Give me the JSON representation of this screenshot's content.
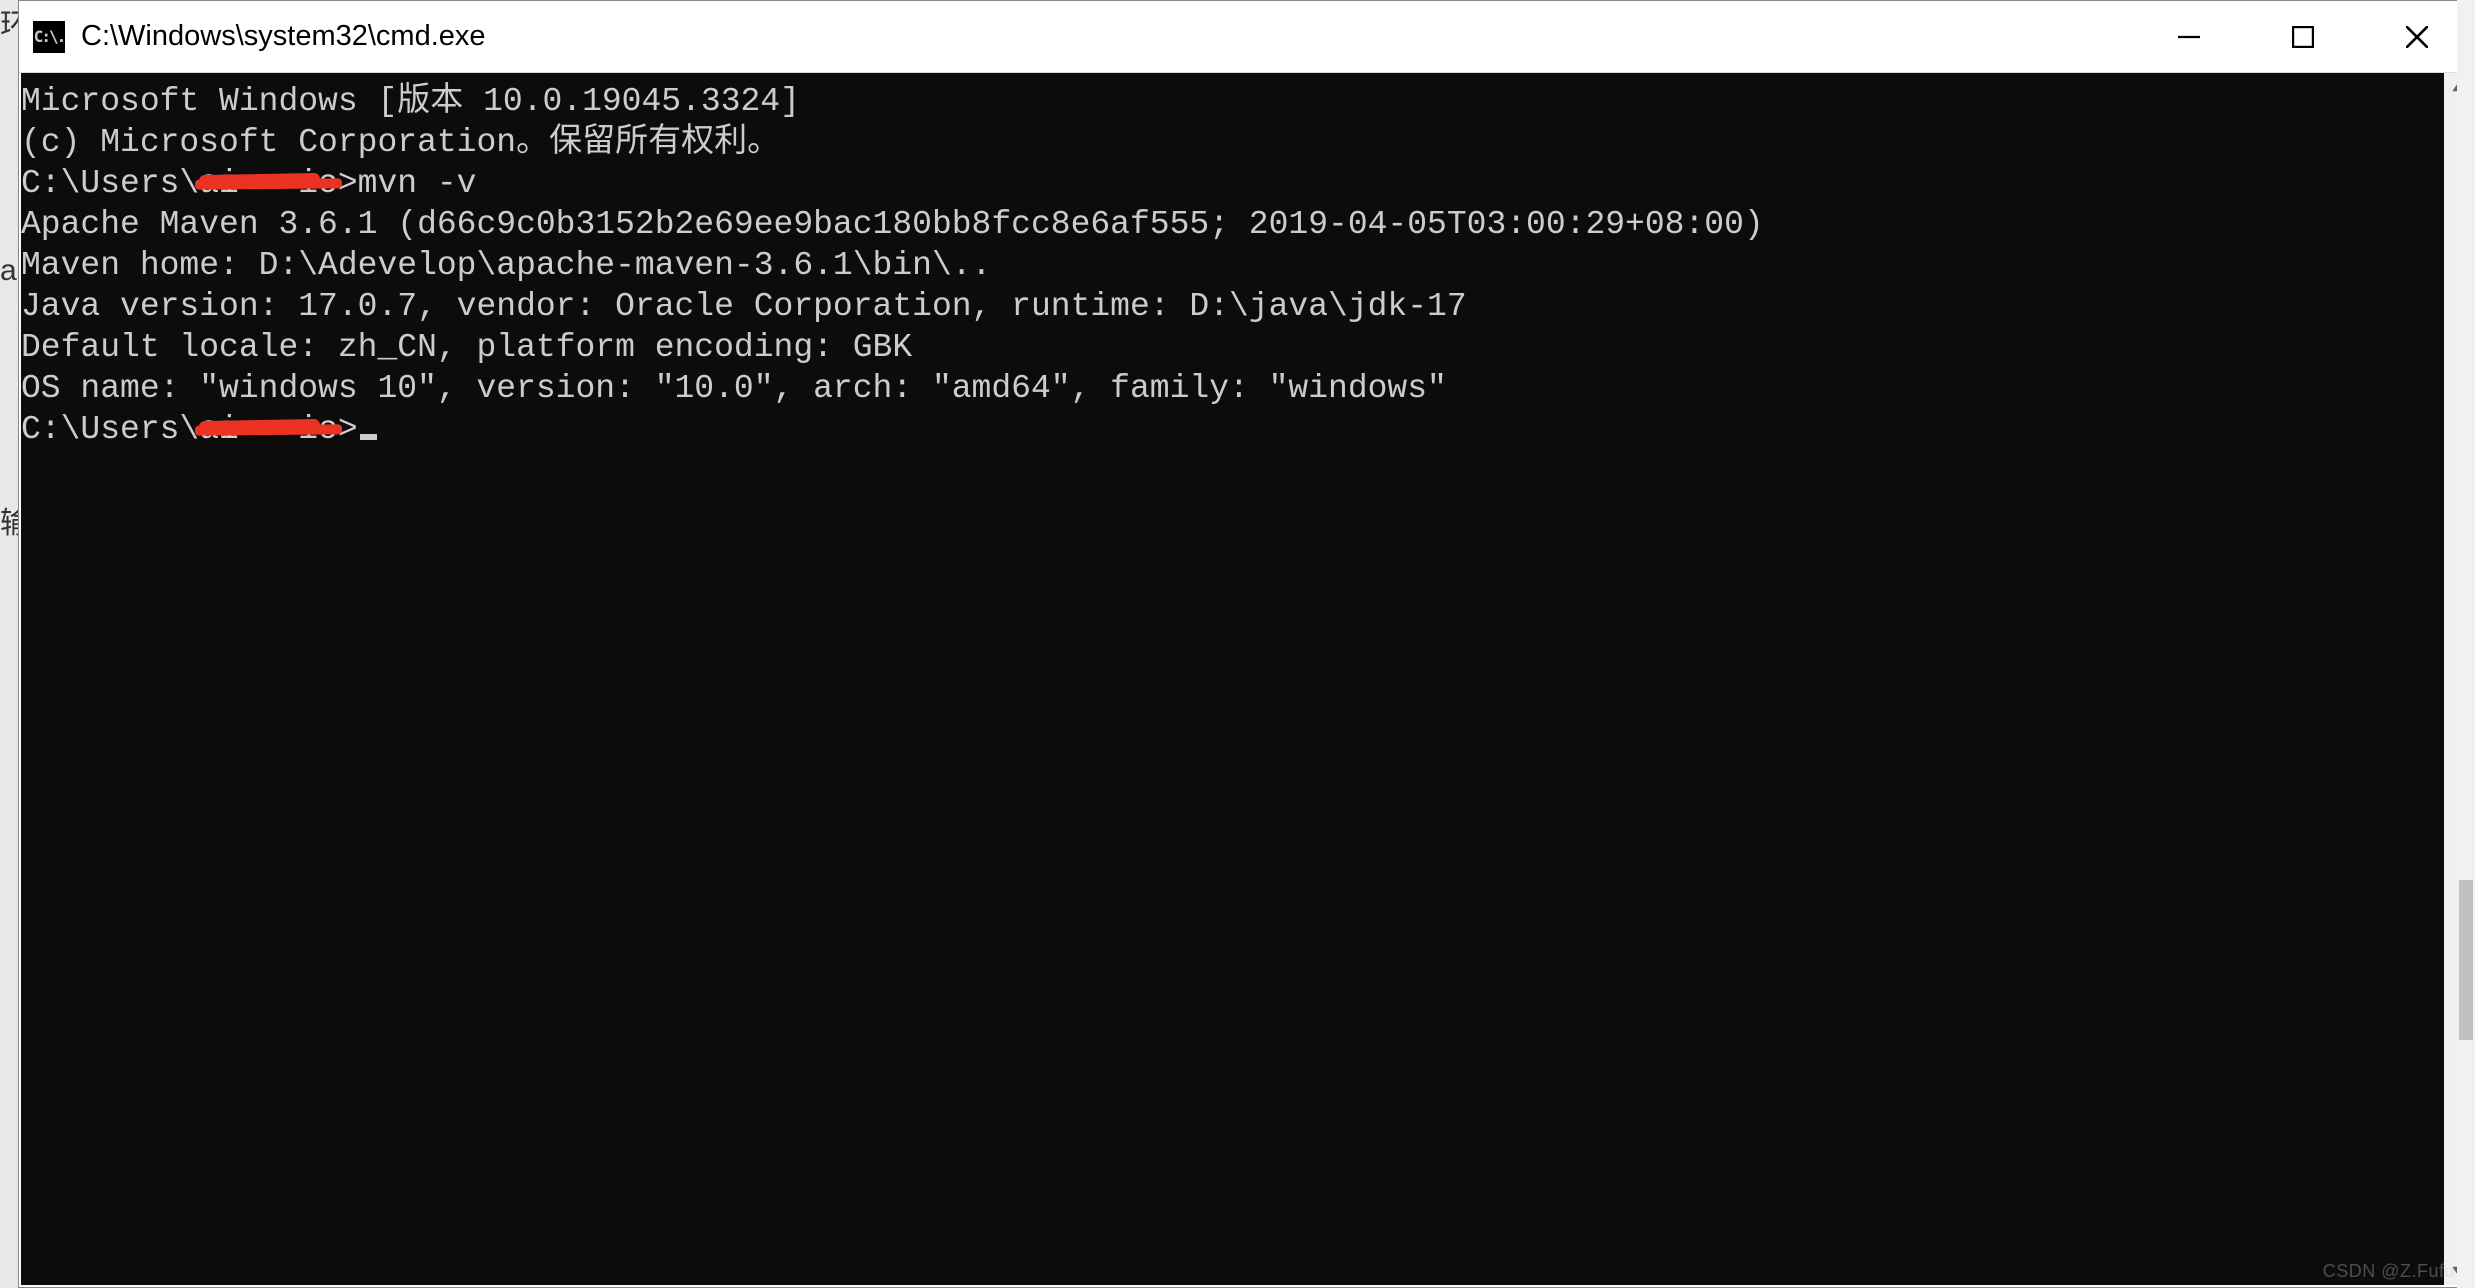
{
  "bg_glyphs": [
    "环",
    "",
    "a",
    "",
    "输"
  ],
  "window": {
    "title": "C:\\Windows\\system32\\cmd.exe",
    "icon_label": "C:\\."
  },
  "terminal": {
    "lines": {
      "l1a": "Microsoft Windows [版本 10.0.19045.3324]",
      "l1b": "(c) Microsoft Corporation。保留所有权利。",
      "blank1": "",
      "prompt1_pre": "C:\\Users\\",
      "prompt1_redacted": "ai   ic",
      "prompt1_post": ">mvn -v",
      "l2": "Apache Maven 3.6.1 (d66c9c0b3152b2e69ee9bac180bb8fcc8e6af555; 2019-04-05T03:00:29+08:00)",
      "l3": "Maven home: D:\\Adevelop\\apache-maven-3.6.1\\bin\\..",
      "l4": "Java version: 17.0.7, vendor: Oracle Corporation, runtime: D:\\java\\jdk-17",
      "l5": "Default locale: zh_CN, platform encoding: GBK",
      "l6": "OS name: \"windows 10\", version: \"10.0\", arch: \"amd64\", family: \"windows\"",
      "blank2": "",
      "prompt2_pre": "C:\\Users\\",
      "prompt2_redacted": "ai   ic",
      "prompt2_post": ">"
    }
  },
  "watermark": "CSDN @Z.Fufu"
}
